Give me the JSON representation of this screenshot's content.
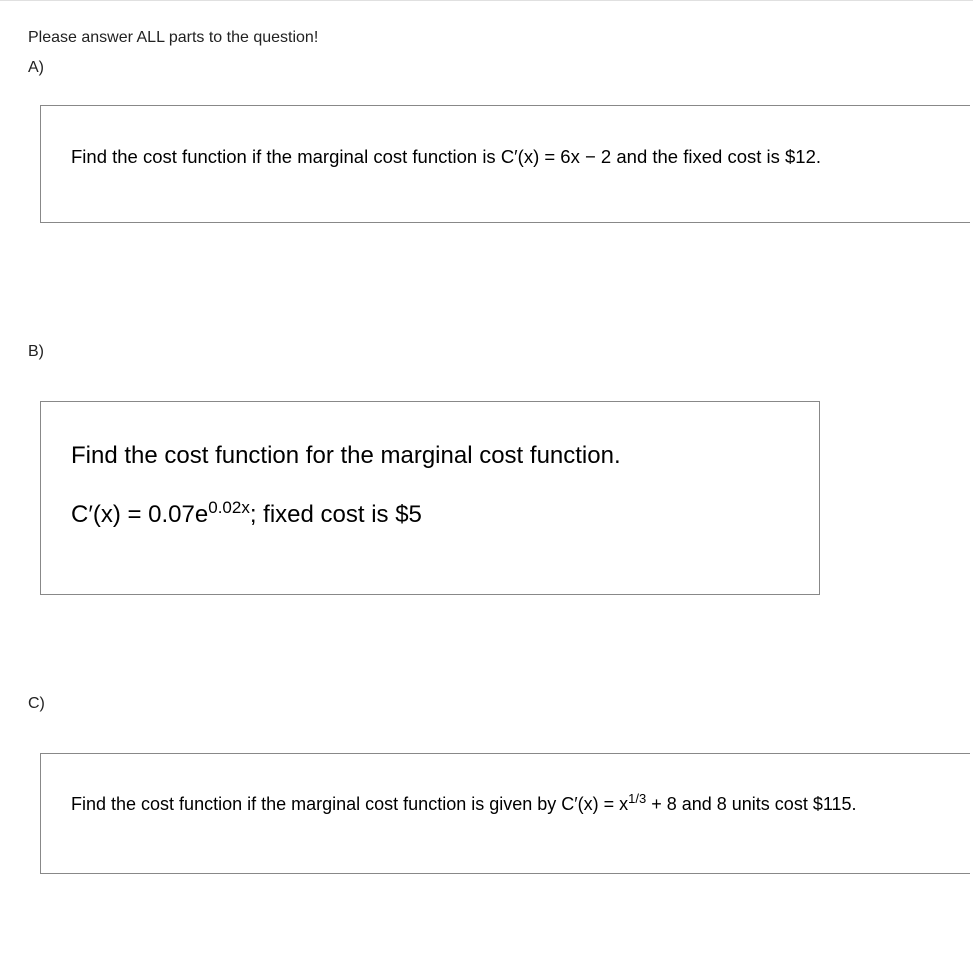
{
  "instruction": "Please answer ALL parts to the question!",
  "parts": {
    "a": {
      "label": "A)",
      "text_pre": "Find the cost function if the marginal cost function is C′(x) = 6x − 2 and the fixed cost is $12."
    },
    "b": {
      "label": "B)",
      "line1": "Find the cost function for the marginal cost function.",
      "line2_pre": "C′(x) = 0.07e",
      "line2_sup": "0.02x",
      "line2_post": "; fixed cost is $5"
    },
    "c": {
      "label": "C)",
      "text_pre": "Find the cost function if the marginal cost function is given by C′(x) = x",
      "text_sup": "1/3",
      "text_post": " + 8 and 8 units cost $115."
    }
  }
}
